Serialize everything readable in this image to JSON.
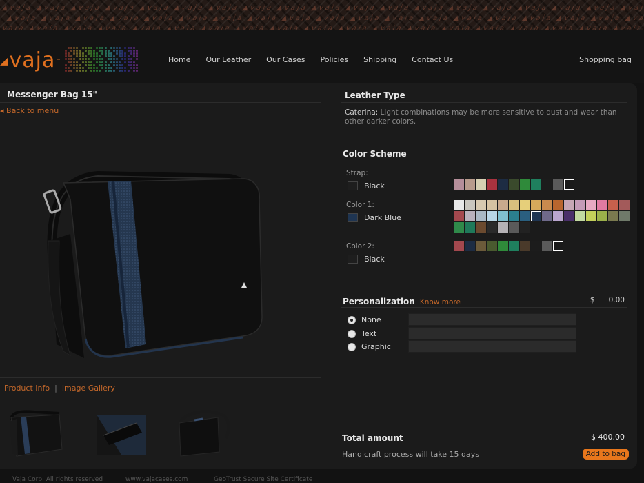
{
  "brand": {
    "logo_text": "vaja",
    "tm": "™"
  },
  "nav": {
    "items": [
      "Home",
      "Our Leather",
      "Our Cases",
      "Policies",
      "Shipping",
      "Contact Us"
    ],
    "shopping_bag": "Shopping bag"
  },
  "product": {
    "title": "Messenger Bag 15\"",
    "back_link": "◂ Back to  menu",
    "tabs": {
      "info": "Product Info",
      "separator": "|",
      "gallery": "Image Gallery"
    }
  },
  "leather": {
    "title": "Leather Type",
    "name": "Caterina:",
    "description": " Light combinations may be more sensitive to dust and wear than other darker colors."
  },
  "color_scheme": {
    "title": "Color Scheme",
    "strap": {
      "label": "Strap:",
      "value": "Black",
      "value_color": "#1e1e1e",
      "palette": [
        "#b58e9a",
        "#b89b8c",
        "#d6cfb2",
        "#a8323f",
        "#1d2c43",
        "#3a4a2c",
        "#2f8a3a",
        "#1f7f5e",
        "#1c1c1c",
        "#5a5a5a",
        "#1a1a1a"
      ],
      "selected_index": 10
    },
    "color1": {
      "label": "Color 1:",
      "value": "Dark Blue",
      "value_color": "#1f3552",
      "palette": [
        "#e8e8e8",
        "#c9c6bf",
        "#d7c9b0",
        "#d6c2a2",
        "#c9a98d",
        "#d9c07e",
        "#e6cf7a",
        "#d6a95b",
        "#c98a4e",
        "#b9662e",
        "#c7a7b5",
        "#c49bb7",
        "#e7a9c2",
        "#e07aa1",
        "#c7604c",
        "#a35a5a",
        "#a3484e",
        "#b8b1bc",
        "#a9b8c4",
        "#b9d6e6",
        "#7fbfcf",
        "#2b7f8f",
        "#2a5f7f",
        "#1f3552",
        "#6f6a8a",
        "#bba6cf",
        "#4a2f6a",
        "#c2d9a0",
        "#c3cf5a",
        "#9bb04a",
        "#7a7a4f",
        "#6f7a6a",
        "#2f8a4a",
        "#1f7a5a",
        "#6b4a2f",
        "#2a2a2a",
        "#b6b3b6",
        "#5a5a5a",
        "#222222"
      ],
      "selected_index": 23
    },
    "color2": {
      "label": "Color 2:",
      "value": "Black",
      "value_color": "#1e1e1e",
      "palette": [
        "#a3484e",
        "#1d2c43",
        "#6b5a3a",
        "#4a5a2f",
        "#2f8a3a",
        "#1f7f5e",
        "#4a3a2a",
        "#1c1c1c",
        "#5a5a5a",
        "#1a1a1a"
      ],
      "selected_index": 9
    }
  },
  "personalization": {
    "title": "Personalization",
    "know_more": "Know more",
    "currency": "$",
    "price": "0.00",
    "options": [
      {
        "label": "None",
        "checked": true
      },
      {
        "label": "Text",
        "checked": false
      },
      {
        "label": "Graphic",
        "checked": false
      }
    ]
  },
  "total": {
    "label": "Total amount",
    "value": "$  400.00",
    "handicraft": "Handicraft process will take  15 days",
    "add_to_bag": "Add to bag"
  },
  "footer": {
    "copyright": "Vaja Corp. All rights reserved",
    "site": "www.vajacases.com",
    "certificate": "GeoTrust Secure Site Certificate"
  },
  "colors": {
    "accent": "#c3672a",
    "button": "#e8771c",
    "background": "#121212",
    "panel": "#1b1b1b"
  }
}
